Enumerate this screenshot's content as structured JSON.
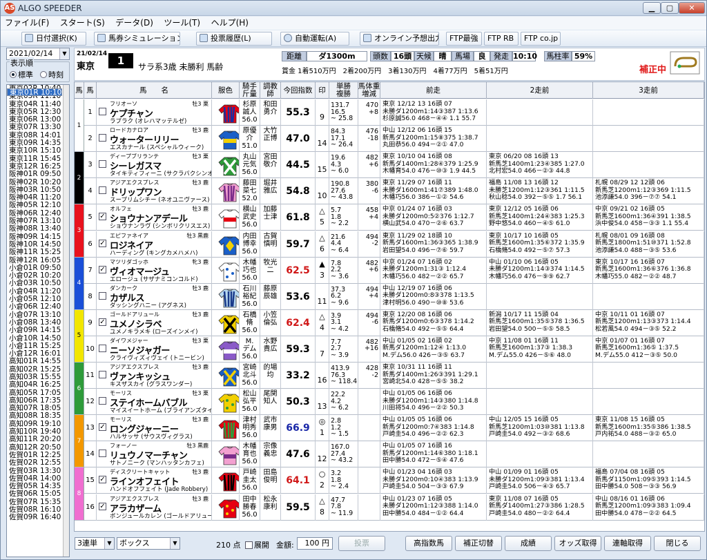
{
  "window": {
    "title": "ALGO SPEEDER",
    "icon_text": "AS"
  },
  "menu": [
    "ファイル(F)",
    "スタート(S)",
    "データ(D)",
    "ツール(T)",
    "ヘルプ(H)"
  ],
  "toolbar": [
    "日付選択(K)",
    "馬券シミュレーション(B)",
    "投票履歴(L)",
    "自動運転(A)",
    "オンライン予想出力",
    "FTP最強",
    "FTP RB",
    "FTP co.jp"
  ],
  "left": {
    "date": "2021/02/14",
    "order_label": "表示順",
    "opt_standard": "標準",
    "opt_time": "時刻",
    "races": [
      "東京01R 10:10",
      "東京02R 10:40",
      "東京03R 11:10",
      "東京04R 11:40",
      "東京05R 12:30",
      "東京06R 13:00",
      "東京07R 13:30",
      "東京08R 14:01",
      "東京09R 14:35",
      "東京10R 15:10",
      "東京11R 15:45",
      "東京12R 16:25",
      "阪神01R 09:50",
      "阪神02R 10:20",
      "阪神03R 10:50",
      "阪神04R 11:20",
      "阪神05R 12:10",
      "阪神06R 12:40",
      "阪神07R 13:10",
      "阪神08R 13:40",
      "阪神09R 14:15",
      "阪神10R 14:50",
      "阪神11R 15:25",
      "阪神12R 16:05",
      "小倉01R 09:50",
      "小倉02R 10:20",
      "小倉03R 10:50",
      "小倉04R 11:20",
      "小倉05R 12:10",
      "小倉06R 12:40",
      "小倉07R 13:10",
      "小倉08R 13:40",
      "小倉09R 14:15",
      "小倉10R 14:50",
      "小倉11R 15:25",
      "小倉12R 16:01",
      "高知01R 14:55",
      "高知02R 15:25",
      "高知03R 15:55",
      "高知04R 16:25",
      "高知05R 17:05",
      "高知06R 17:35",
      "高知07R 18:05",
      "高知08R 18:35",
      "高知09R 19:10",
      "高知10R 19:40",
      "高知11R 20:20",
      "高知12R 20:50",
      "佐賀01R 12:25",
      "佐賀02R 12:55",
      "佐賀03R 13:30",
      "佐賀04R 14:00",
      "佐賀05R 14:35",
      "佐賀06R 15:05",
      "佐賀07R 15:35",
      "佐賀08R 16:10",
      "佐賀09R 16:40"
    ]
  },
  "race": {
    "date": "21/02/14",
    "venue": "東京",
    "number": "1",
    "conditions": "サラ系3歳 未勝利 馬齢",
    "dist_label": "距離",
    "dist": "ダ1300m",
    "runners_label": "頭数",
    "runners": "16頭",
    "weather_label": "天候",
    "weather": "晴",
    "track_label": "馬場",
    "track": "良",
    "post_label": "発走",
    "post": "10:10",
    "rate_label": "馬柱率",
    "rate": "59%",
    "prize": "賞金 1着510万円　2着200万円　3着130万円　4着77万円　5着51万円",
    "hosei": "補正中"
  },
  "header": {
    "waku": "馬",
    "uma": "馬",
    "name": "馬　　名",
    "color": "服色",
    "jockey": "騎手\n斤量",
    "trainer": "調教\n師",
    "idx": "今回指数",
    "mark": "印",
    "odds": "単勝\n複勝",
    "weight": "馬体重\n増減",
    "p1": "前走",
    "p2": "2走前",
    "p3": "3走前"
  },
  "horses": [
    {
      "waku": "1",
      "wcolor": "#ffffff",
      "wtext": "#000",
      "no": "1",
      "chk": false,
      "sire": "フリオーソ",
      "sex": "牡3 栗",
      "name": "ケプチャン",
      "dam": "ラブラク (オレハマッテルゼ)",
      "silk": {
        "b": "#e60012",
        "s": "#1a2fa0",
        "p": "stripes"
      },
      "jockey": "杉原\n誠人\n56.0",
      "trainer": "和田\n勇介",
      "idx": "55.3",
      "icolor": "#000",
      "mark": "",
      "mnum": "9",
      "odds": "131.7\n16.5\n~ 25.8",
      "wt": "470\n+8",
      "p1": [
        "東京 12/12   13 16頭 07",
        "未勝ダ1200m1:14③387 1:13.6",
        "杉原誠56.0 468－④④ 1.1 55.7"
      ],
      "p2": [
        "",
        "",
        ""
      ],
      "p3": [
        "",
        "",
        ""
      ]
    },
    {
      "waku": "1",
      "wcolor": "#ffffff",
      "wtext": "#000",
      "no": "2",
      "chk": false,
      "sire": "ロードカナロア",
      "sex": "牡3 鹿",
      "name": "ウォーターリリー",
      "dam": "エスカナール (スペシャルウィーク)",
      "silk": {
        "b": "#1a5fc8",
        "s": "#f2d000",
        "p": "band"
      },
      "jockey": "原優\n介\n51.0",
      "trainer": "大竹\n正博",
      "idx": "47.0",
      "icolor": "#000",
      "mark": "",
      "mnum": "14",
      "odds": "84.3\n17.1\n~ 26.4",
      "wt": "476\n-18",
      "p1": [
        "中山 12/12   06 16頭 15",
        "新馬ダ1200m1:15⑧375 1:38.7",
        "丸田恭56.0 494－②① 47.0"
      ],
      "p2": [
        "",
        "",
        ""
      ],
      "p3": [
        "",
        "",
        ""
      ]
    },
    {
      "waku": "2",
      "wcolor": "#000000",
      "wtext": "#fff",
      "no": "3",
      "chk": false,
      "sire": "ディープブリランテ",
      "sex": "牡3 栗",
      "name": "シーレガスマ",
      "dam": "タイキティフィーニ (サクラバクシンオー)",
      "silk": {
        "b": "#2e9b3a",
        "s": "#ffffff",
        "p": "cross"
      },
      "jockey": "丸山\n元気\n56.0",
      "trainer": "宮田\n敬介",
      "idx": "44.5",
      "icolor": "#000",
      "mark": "",
      "mnum": "15",
      "odds": "19.6\n4.3\n~ 6.0",
      "wt": "482\n+6",
      "p1": [
        "東京 10/10   04 16頭 08",
        "新馬ダ1400m1:28④379 1:25.9",
        "木幡育54.0 476－⑩③ 1.9 44.5"
      ],
      "p2": [
        "東京 06/20   08 16頭 13",
        "新馬芝1400m1:23④385 1:27.0",
        "北村宏54.0 466－②③ 44.8"
      ],
      "p3": [
        "",
        "",
        ""
      ]
    },
    {
      "waku": "2",
      "wcolor": "#000000",
      "wtext": "#fff",
      "no": "4",
      "chk": false,
      "sire": "アジアエクスプレス",
      "sex": "牡3 鹿",
      "name": "ドリップワン",
      "dam": "スープリムシチー (ネオユニヴァース)",
      "silk": {
        "b": "#f2a0d0",
        "s": "#7a2c8a",
        "p": "stripes"
      },
      "jockey": "藤田\n菜七\n52.0",
      "trainer": "堀井\n雅広",
      "idx": "54.8",
      "icolor": "#000",
      "mark": "",
      "mnum": "10",
      "odds": "190.8\n27.6\n~ 43.8",
      "wt": "380\n-6",
      "p1": [
        "東京 11/29   07 16頭 11",
        "未勝ダ1600m1:41⑦389 1:48.0",
        "木幡巧56.0 386－①② 54.6"
      ],
      "p2": [
        "福島 11/08   13 16頭 12",
        "未勝芝1200m1:12③361 1:11.5",
        "秋山稔54.0 392－⑤⑤ 1.7 56.1"
      ],
      "p3": [
        "札幌 08/29   12 12頭 06",
        "新馬芝1200m1:12③369 1:11.5",
        "池添謙54.0 396－⑦⑦ 54.1"
      ]
    },
    {
      "waku": "3",
      "wcolor": "#e8121e",
      "wtext": "#fff",
      "no": "5",
      "chk": true,
      "sire": "オルフェ",
      "sex": "牡3 鹿",
      "name": "ショウナンアデール",
      "dam": "ショウナンラヴ (シンボリクリスエス)",
      "silk": {
        "b": "#ffffff",
        "s": "#e60012",
        "p": "band"
      },
      "jockey": "横山\n武史\n56.0",
      "trainer": "加藤\n士津",
      "idx": "61.8",
      "icolor": "#000",
      "mark": "△",
      "mnum": "5",
      "odds": "5.7\n1.8\n~ 2.2",
      "wt": "458\n+4",
      "p1": [
        "中京 01/24   07 16頭 03",
        "未勝ダ1200m0:5②376 1:12.7",
        "横山武54.0 470－②⑥ 63.7"
      ],
      "p2": [
        "東京 12/12   05 16頭 06",
        "新馬芝1400m1:24④383 1:25.3",
        "野中悠54.0 460－④⑤ 61.0"
      ],
      "p3": [
        "中京 09/21   02 16頭 05",
        "新馬芝1600m1:36④391 1:38.5",
        "浜中俊54.0 458－③③ 1.1 55.4"
      ]
    },
    {
      "waku": "3",
      "wcolor": "#e8121e",
      "wtext": "#fff",
      "no": "6",
      "chk": true,
      "sire": "エピファネイア",
      "sex": "牡3 黒鹿",
      "name": "ロジネイア",
      "dam": "ハーディング (キングカメハメハ)",
      "silk": {
        "b": "#1a5fc8",
        "s": "#f2d000",
        "p": "diamond"
      },
      "jockey": "内田\n博幸\n56.0",
      "trainer": "古賀\n慎明",
      "idx": "59.7",
      "icolor": "#000",
      "mark": "△",
      "mnum": "6",
      "odds": "21.6\n4.4\n~ 6.4",
      "wt": "494\n-2",
      "p1": [
        "東京 11/29   02 18頭 10",
        "新馬ダ1600m1:36③365 1:38.9",
        "岩田望54.0 496－⑦⑥ 59.7"
      ],
      "p2": [
        "東京 10/17   10 16頭 05",
        "新馬芝1600m1:35⑥372 1:35.9",
        "石橋脩54.0 492－⑤⑦ 57.3"
      ],
      "p3": [
        "札幌 08/01   09 16頭 08",
        "新馬芝1800m1:51⑩371 1:52.8",
        "池添謙54.0 488－③⑤ 53.6"
      ]
    },
    {
      "waku": "4",
      "wcolor": "#1a4fd8",
      "wtext": "#fff",
      "no": "7",
      "chk": true,
      "sire": "マツリダゴッホ",
      "sex": "牝3 鹿",
      "name": "ヴィオマージュ",
      "dam": "エロージュ (サザナミコンコルド)",
      "silk": {
        "b": "#ffffff",
        "s": "#1a5fc8",
        "p": "dots"
      },
      "jockey": "木幡\n巧也\n56.0",
      "trainer": "牧光\n二",
      "idx": "62.5",
      "icolor": "#d01818",
      "mark": "▲",
      "mnum": "3",
      "odds": "7.8\n2.2\n~ 3.6",
      "wt": "482\n+6",
      "p1": [
        "中京 01/24   07 16頭 02",
        "未勝ダ1200m1:31③ 1:12.4",
        "木幡巧56.0 482－②② 65.7"
      ],
      "p2": [
        "中山 01/10   06 16頭 05",
        "未勝ダ1200m1:14③374 1:14.5",
        "木幡巧56.0 476－⑨⑨ 62.7"
      ],
      "p3": [
        "東京 10/17   16 16頭 07",
        "新馬芝1600m1:36⑥376 1:36.8",
        "木幡巧55.0 482－②② 48.7"
      ]
    },
    {
      "waku": "4",
      "wcolor": "#1a4fd8",
      "wtext": "#fff",
      "no": "8",
      "chk": false,
      "sire": "ダンカーク",
      "sex": "牡3 鹿",
      "name": "カザルス",
      "dam": "ダッシングハニー (アグネス)",
      "silk": {
        "b": "#b8d8f0",
        "s": "#1a3a8a",
        "p": "stripes"
      },
      "jockey": "石川\n裕紀\n56.0",
      "trainer": "藤原\n辰雄",
      "idx": "53.6",
      "icolor": "#000",
      "mark": "",
      "mnum": "11",
      "odds": "37.3\n6.2\n~ 9.6",
      "wt": "494\n+4",
      "p1": [
        "中山 12/19   07 16頭 06",
        "未勝ダ1200m0:8③378 1:13.5",
        "津村明56.0 490－⑩⑧ 53.6"
      ],
      "p2": [
        "",
        "",
        ""
      ],
      "p3": [
        "",
        "",
        ""
      ]
    },
    {
      "waku": "5",
      "wcolor": "#f2e600",
      "wtext": "#000",
      "no": "9",
      "chk": true,
      "sire": "ゴールドアリュール",
      "sex": "牡3 鹿",
      "name": "ユメノシラベ",
      "dam": "ユメノキラメキ (ローズインメイ)",
      "silk": {
        "b": "#f2d000",
        "s": "#000000",
        "p": "cross"
      },
      "jockey": "石橋\n脩\n56.0",
      "trainer": "小笠\n倫弘",
      "idx": "62.4",
      "icolor": "#d01818",
      "mark": "△",
      "mnum": "4",
      "odds": "3.9\n3.1\n~ 4.2",
      "wt": "494\n-6",
      "p1": [
        "東京 12/20   08 16頭 06",
        "新馬ダ1200m0:6③378 1:14.2",
        "石橋脩54.0 492－⑤⑤ 64.4"
      ],
      "p2": [
        "新潟 10/17   11 15頭 04",
        "新馬芝1600m1:35⑤378 1:36.5",
        "岩田望54.0 500－⑤⑤ 58.5"
      ],
      "p3": [
        "中京 10/11   01 16頭 07",
        "新馬芝1200m1:13③373 1:14.4",
        "松若風54.0 494－③⑤ 52.2"
      ]
    },
    {
      "waku": "5",
      "wcolor": "#f2e600",
      "wtext": "#000",
      "no": "10",
      "chk": false,
      "sire": "ダイワメジャー",
      "sex": "牡3 栗",
      "name": "ニーソジャガー",
      "dam": "クライヴィズィヴェイ (トニービン)",
      "silk": {
        "b": "#8a5ac8",
        "s": "#ffffff",
        "p": "band"
      },
      "jockey": "M.\nデム\n56.0",
      "trainer": "水野\n貴広",
      "idx": "59.3",
      "icolor": "#000",
      "mark": "",
      "mnum": "7",
      "odds": "7.7\n2.7\n~ 3.9",
      "wt": "482\n+16",
      "p1": [
        "中山 01/05   02 16頭 02",
        "新馬ダ1200m1:12④ 1:13.0",
        "M.デム56.0 426－③⑤ 63.7"
      ],
      "p2": [
        "中京 11/08   01 16頭 11",
        "新馬芝1600m1:37③ 1:38.3",
        "M.デム55.0 426－⑤⑥ 48.0"
      ],
      "p3": [
        "中京 01/07   01 16頭 07",
        "新馬芝1600m1:36⑤ 1:37.5",
        "M.デム55.0 412－③⑤ 50.0"
      ]
    },
    {
      "waku": "6",
      "wcolor": "#2e9b3a",
      "wtext": "#fff",
      "no": "11",
      "chk": false,
      "sire": "アジアエクスプレス",
      "sex": "牡3 鹿",
      "name": "ヴァンキッシュ",
      "dam": "キスザスカイ (グラスワンダー)",
      "silk": {
        "b": "#1a5fc8",
        "s": "#f2d000",
        "p": "cross"
      },
      "jockey": "宮崎\n北斗\n56.0",
      "trainer": "的場\n均",
      "idx": "33.2",
      "icolor": "#000",
      "mark": "",
      "mnum": "16",
      "odds": "413.9\n76.3\n~ 118.4",
      "wt": "428\n-2",
      "p1": [
        "東京 10/31   11 16頭 11",
        "新馬ダ1400m1:26③391 1:29.1",
        "宮崎北54.0 428－⑤⑤ 38.2"
      ],
      "p2": [
        "",
        "",
        ""
      ],
      "p3": [
        "",
        "",
        ""
      ]
    },
    {
      "waku": "6",
      "wcolor": "#2e9b3a",
      "wtext": "#fff",
      "no": "12",
      "chk": false,
      "sire": "モーリス",
      "sex": "牡3 栗",
      "name": "ステイホームバブル",
      "dam": "マイスイートホーム (ブライアンズタイム)",
      "silk": {
        "b": "#f2d000",
        "s": "#2e9b3a",
        "p": "dots"
      },
      "jockey": "松山\n弘平\n56.0",
      "trainer": "尾関\n知人",
      "idx": "50.3",
      "icolor": "#000",
      "mark": "",
      "mnum": "13",
      "odds": "22.2\n4.2\n~ 6.2",
      "wt": "",
      "p1": [
        "中山 01/05   06 16頭 06",
        "未勝ダ1200m1:14③380 1:14.8",
        "川田将54.0 496－②② 50.3"
      ],
      "p2": [
        "",
        "",
        ""
      ],
      "p3": [
        "",
        "",
        ""
      ]
    },
    {
      "waku": "7",
      "wcolor": "#f39800",
      "wtext": "#fff",
      "no": "13",
      "chk": true,
      "sire": "モーリス",
      "sex": "牡3 鹿",
      "name": "ロングジャーニー",
      "dam": "ハルサッサ (サウスヴィグラス)",
      "silk": {
        "b": "#e60012",
        "s": "#2e9b3a",
        "p": "stripes"
      },
      "jockey": "津村\n明秀\n56.0",
      "trainer": "武市\n康男",
      "idx": "66.9",
      "icolor": "#1a28a8",
      "mark": "◎",
      "mnum": "1",
      "odds": "2.8\n1.2\n~ 1.5",
      "wt": "",
      "p1": [
        "中山 01/05   05 16頭 06",
        "新馬ダ1200m0:7④383 1:14.8",
        "戸崎圭54.0 496－②② 62.3"
      ],
      "p2": [
        "中山 12/05   15 16頭 05",
        "新馬芝1200m1:03⑩381 1:13.8",
        "戸崎圭54.0 492－③② 68.6"
      ],
      "p3": [
        "東京 11/08   15 16頭 05",
        "新馬芝1600m1:35⑤386 1:38.5",
        "戸内祐54.0 488－③② 65.0"
      ]
    },
    {
      "waku": "7",
      "wcolor": "#f39800",
      "wtext": "#fff",
      "no": "14",
      "chk": false,
      "sire": "フォーノー",
      "sex": "牡3 黒鹿",
      "name": "リュウノマーチャン",
      "dam": "サトノニーク (マンハッタンカフェ)",
      "silk": {
        "b": "#f2a0d0",
        "s": "#7a2c8a",
        "p": "band"
      },
      "jockey": "木幡\n育也\n56.0",
      "trainer": "宗像\n義忠",
      "idx": "47.6",
      "icolor": "#000",
      "mark": "",
      "mnum": "12",
      "odds": "167.0\n27.4\n~ 43.2",
      "wt": "",
      "p1": [
        "中山 01/05   07 16頭 16",
        "新馬ダ1200m1:14⑥380 1:18.1",
        "田中勝54.0 472－⑤④ 47.6"
      ],
      "p2": [
        "",
        "",
        ""
      ],
      "p3": [
        "",
        "",
        ""
      ]
    },
    {
      "waku": "8",
      "wcolor": "#f06ed0",
      "wtext": "#fff",
      "no": "15",
      "chk": true,
      "sire": "ディスクリートキャット",
      "sex": "牡3 鹿",
      "name": "ラインオフェイト",
      "dam": "ハンドオフフェイト (Jade Robbery)",
      "silk": {
        "b": "#e60012",
        "s": "#000000",
        "p": "stripes"
      },
      "jockey": "戸崎\n圭太\n56.0",
      "trainer": "田島\n俊明",
      "idx": "64.1",
      "icolor": "#d01818",
      "mark": "○",
      "mnum": "2",
      "odds": "3.2\n1.8\n~ 2.4",
      "wt": "",
      "p1": [
        "中山 01/23   04 16頭 03",
        "未勝ダ1200m0:10④383 1:13.9",
        "戸崎圭54.0 504－③③ 67.9"
      ],
      "p2": [
        "中山 01/09   01 16頭 05",
        "未勝ダ1200m1:09③381 1:13.4",
        "戸崎圭54.0 506－④③ 65.7"
      ],
      "p3": [
        "福島 07/04   08 16頭 05",
        "新馬ダ1150m1:09⑤393 1:14.5",
        "田中勝54.0 508－③③ 56.9"
      ]
    },
    {
      "waku": "8",
      "wcolor": "#f06ed0",
      "wtext": "#fff",
      "no": "16",
      "chk": true,
      "sire": "アジアエクスプレス",
      "sex": "牡3 鹿",
      "name": "アラカザーム",
      "dam": "ボンジュールカレン (ゴールドアリュール)",
      "silk": {
        "b": "#e60012",
        "s": "#f2d000",
        "p": "dots"
      },
      "jockey": "田中\n勝春\n56.0",
      "trainer": "松永\n康利",
      "idx": "59.5",
      "icolor": "#000",
      "mark": "△",
      "mnum": "8",
      "odds": "47.7\n7.8\n~ 11.9",
      "wt": "",
      "p1": [
        "中山 01/23   07 16頭 05",
        "未勝ダ1200m1:12③388 1:14.0",
        "田中勝54.0 484－①② 64.4"
      ],
      "p2": [
        "東京 11/08   07 16頭 05",
        "新馬ダ1400m1:27③386 1:28.5",
        "戸崎圭54.0 480－②② 64.4"
      ],
      "p3": [
        "中山 08/16   01 16頭 06",
        "新馬芝1200m1:09③383 1:09.4",
        "田中勝54.0 478－②② 64.5"
      ]
    }
  ],
  "bottom": {
    "bet_type": "3連単",
    "bet_mode": "ボックス",
    "points": "210 点",
    "expand": "展開",
    "amount_label": "金額:",
    "amount": "100 円",
    "vote": "投票",
    "buttons": [
      "高指数馬",
      "補正切替",
      "成績",
      "オッズ取得",
      "連軸取得",
      "閉じる"
    ]
  },
  "colors": {
    "accent": "#2f6dc4",
    "hosei": "#e01818",
    "high": "#d01818",
    "top": "#1a28a8"
  }
}
